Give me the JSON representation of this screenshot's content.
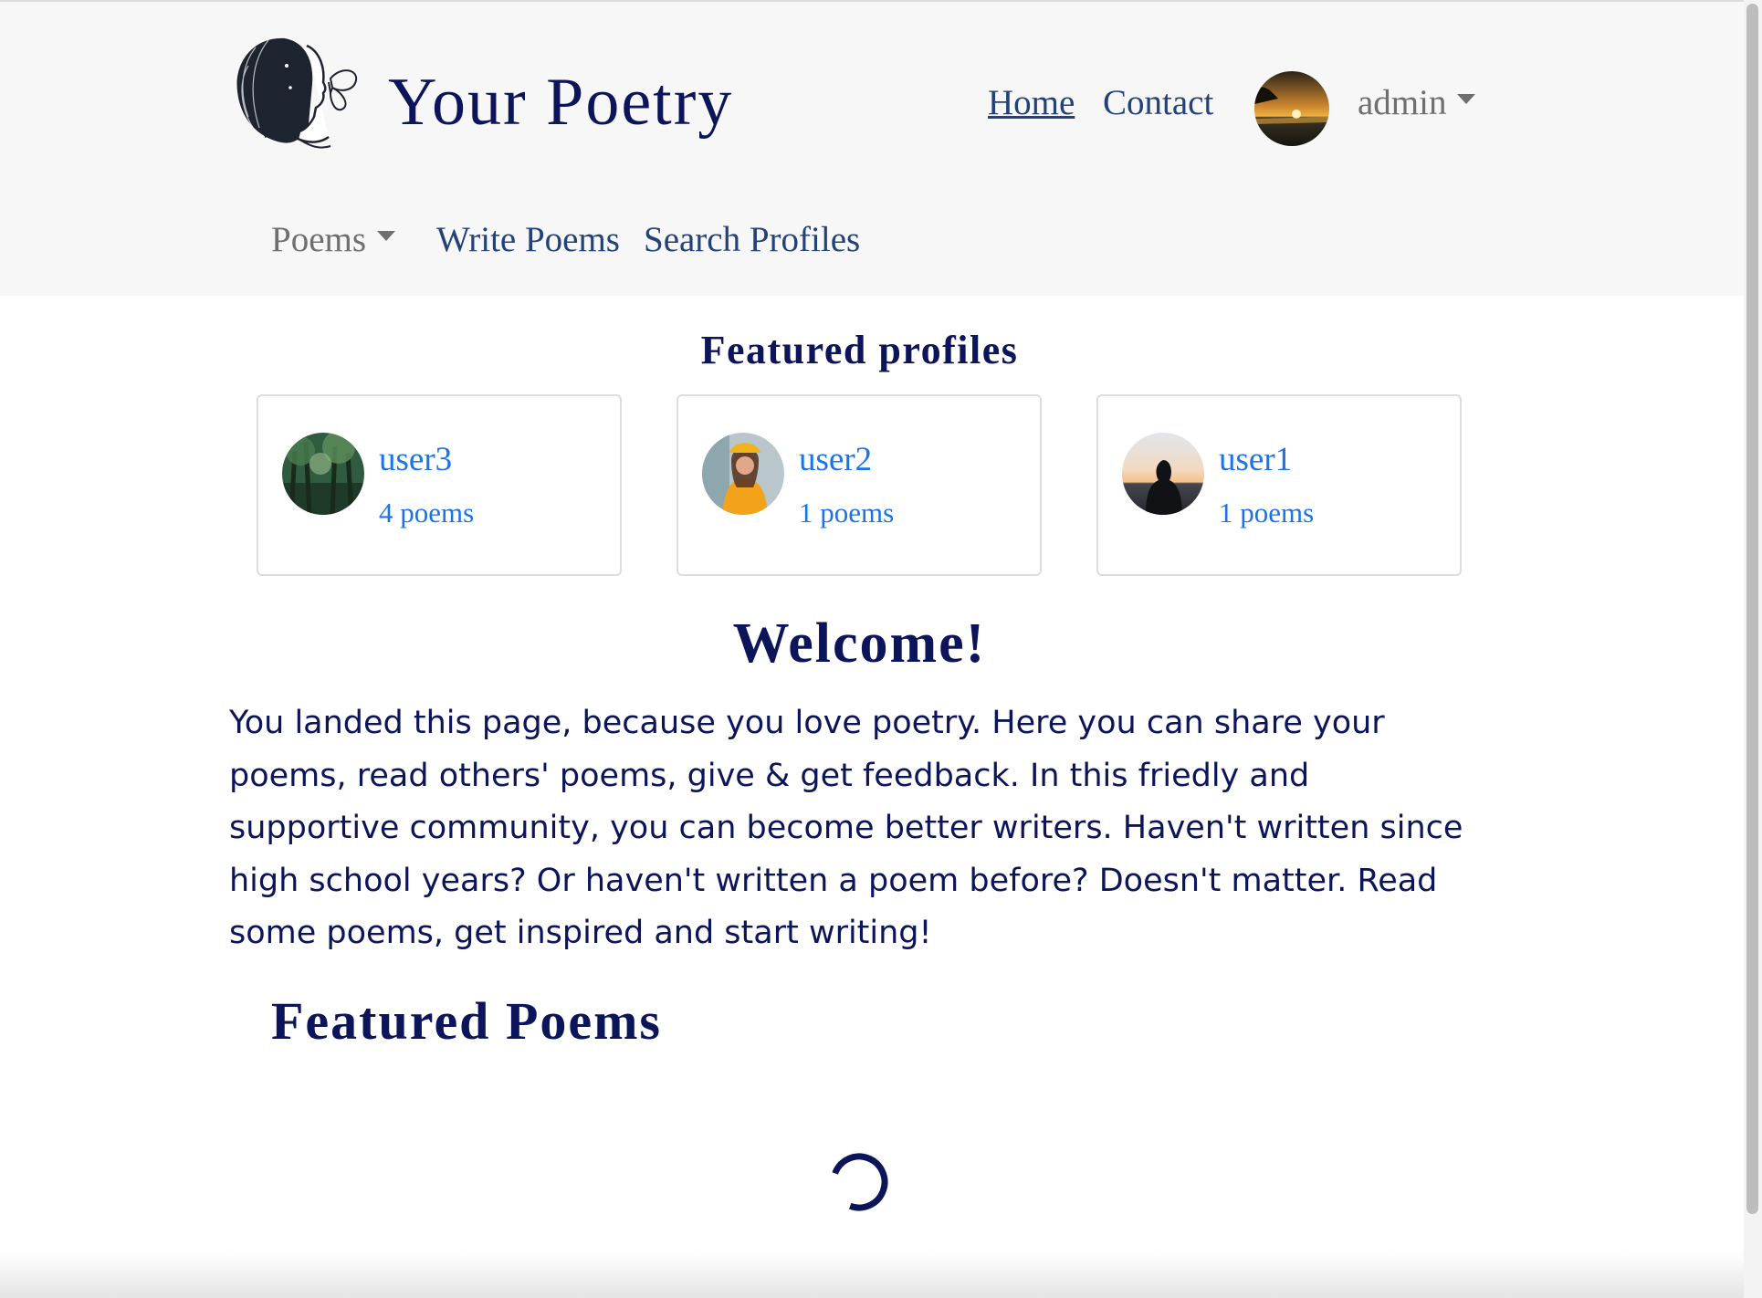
{
  "brand": {
    "title": "Your Poetry",
    "logo_icon": "woman-butterfly-logo-icon"
  },
  "nav": {
    "home": "Home",
    "contact": "Contact",
    "user_name": "admin",
    "user_avatar": "sunset-avatar",
    "poems": "Poems",
    "write_poems": "Write Poems",
    "search_profiles": "Search Profiles"
  },
  "featured_profiles": {
    "title": "Featured profiles",
    "items": [
      {
        "name": "user3",
        "poems": "4 poems",
        "avatar": "forest-avatar"
      },
      {
        "name": "user2",
        "poems": "1 poems",
        "avatar": "yellow-hoodie-avatar"
      },
      {
        "name": "user1",
        "poems": "1 poems",
        "avatar": "silhouette-sunset-avatar"
      }
    ]
  },
  "welcome": {
    "title": "Welcome!",
    "text": "You landed this page, because you love poetry. Here you can share your poems, read others' poems, give & get feedback. In this friedly and supportive community, you can become better writers. Haven't written since high school years? Or haven't written a poem before? Doesn't matter. Read some poems, get inspired and start writing!"
  },
  "featured_poems": {
    "title": "Featured Poems",
    "loading_icon": "loading-spinner-icon"
  },
  "colors": {
    "primary_text": "#0c1559",
    "nav_link": "#23427a",
    "profile_link": "#1a73e8",
    "navbar_bg": "#f7f7f8",
    "muted": "#6f6f6f"
  }
}
